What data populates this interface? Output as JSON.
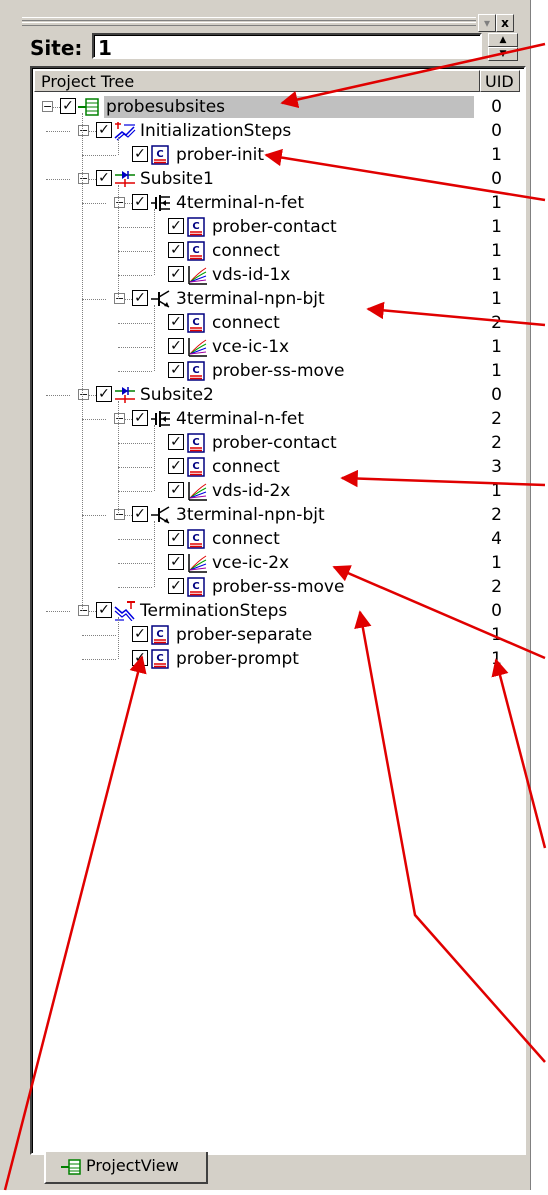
{
  "site": {
    "label": "Site:",
    "value": "1"
  },
  "window_buttons": {
    "dropdown": "▾",
    "close": "x"
  },
  "tree": {
    "headers": {
      "name": "Project Tree",
      "uid": "UID"
    },
    "rows": [
      {
        "label": "probesubsites",
        "uid": "0",
        "icon": "project-icon",
        "expanded": true,
        "selected": true
      },
      {
        "label": "InitializationSteps",
        "uid": "0",
        "icon": "init-steps-icon",
        "expanded": true
      },
      {
        "label": "prober-init",
        "uid": "1",
        "icon": "script-icon"
      },
      {
        "label": "Subsite1",
        "uid": "0",
        "icon": "subsite-icon",
        "expanded": true
      },
      {
        "label": "4terminal-n-fet",
        "uid": "1",
        "icon": "fet-device-icon",
        "expanded": true
      },
      {
        "label": "prober-contact",
        "uid": "1",
        "icon": "script-icon"
      },
      {
        "label": "connect",
        "uid": "1",
        "icon": "script-icon"
      },
      {
        "label": "vds-id-1x",
        "uid": "1",
        "icon": "graph-test-icon"
      },
      {
        "label": "3terminal-npn-bjt",
        "uid": "1",
        "icon": "bjt-device-icon",
        "expanded": true
      },
      {
        "label": "connect",
        "uid": "2",
        "icon": "script-icon"
      },
      {
        "label": "vce-ic-1x",
        "uid": "1",
        "icon": "graph-test-icon"
      },
      {
        "label": "prober-ss-move",
        "uid": "1",
        "icon": "script-icon"
      },
      {
        "label": "Subsite2",
        "uid": "0",
        "icon": "subsite-icon",
        "expanded": true
      },
      {
        "label": "4terminal-n-fet",
        "uid": "2",
        "icon": "fet-device-icon",
        "expanded": true
      },
      {
        "label": "prober-contact",
        "uid": "2",
        "icon": "script-icon"
      },
      {
        "label": "connect",
        "uid": "3",
        "icon": "script-icon"
      },
      {
        "label": "vds-id-2x",
        "uid": "1",
        "icon": "graph-test-icon"
      },
      {
        "label": "3terminal-npn-bjt",
        "uid": "2",
        "icon": "bjt-device-icon",
        "expanded": true
      },
      {
        "label": "connect",
        "uid": "4",
        "icon": "script-icon"
      },
      {
        "label": "vce-ic-2x",
        "uid": "1",
        "icon": "graph-test-icon"
      },
      {
        "label": "prober-ss-move",
        "uid": "2",
        "icon": "script-icon"
      },
      {
        "label": "TerminationSteps",
        "uid": "0",
        "icon": "term-steps-icon",
        "expanded": true
      },
      {
        "label": "prober-separate",
        "uid": "1",
        "icon": "script-icon"
      },
      {
        "label": "prober-prompt",
        "uid": "1",
        "icon": "script-icon"
      }
    ]
  },
  "tab": {
    "label": "ProjectView",
    "icon": "project-icon"
  },
  "colors": {
    "panel": "#d4d0c8",
    "annotation_arrow": "#e00000",
    "selection": "#c0c0c0"
  }
}
